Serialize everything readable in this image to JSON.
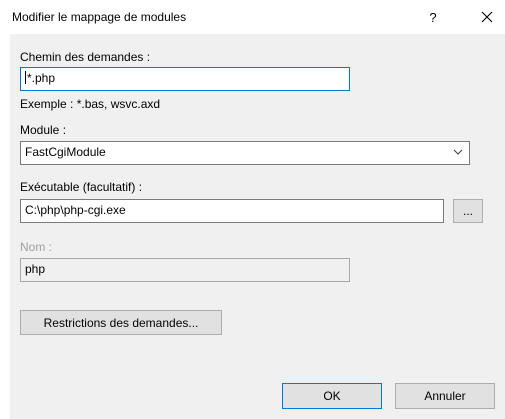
{
  "dialog": {
    "title": "Modifier le mappage de modules",
    "help_glyph": "?",
    "close_glyph": "×"
  },
  "request_path": {
    "label": "Chemin des demandes :",
    "value": "*.php",
    "example": "Exemple : *.bas, wsvc.axd"
  },
  "module": {
    "label": "Module :",
    "selected": "FastCgiModule",
    "icon": "chevron-down-icon"
  },
  "executable": {
    "label": "Exécutable (facultatif) :",
    "value": "C:\\php\\php-cgi.exe",
    "browse_label": "..."
  },
  "name": {
    "label": "Nom :",
    "value": "php"
  },
  "buttons": {
    "restrictions": "Restrictions des demandes...",
    "ok": "OK",
    "cancel": "Annuler"
  },
  "colors": {
    "accent": "#0078d7",
    "dialog_bg": "#f0f0f0",
    "button_bg": "#e1e1e1",
    "disabled_text": "#a0a0a0"
  }
}
